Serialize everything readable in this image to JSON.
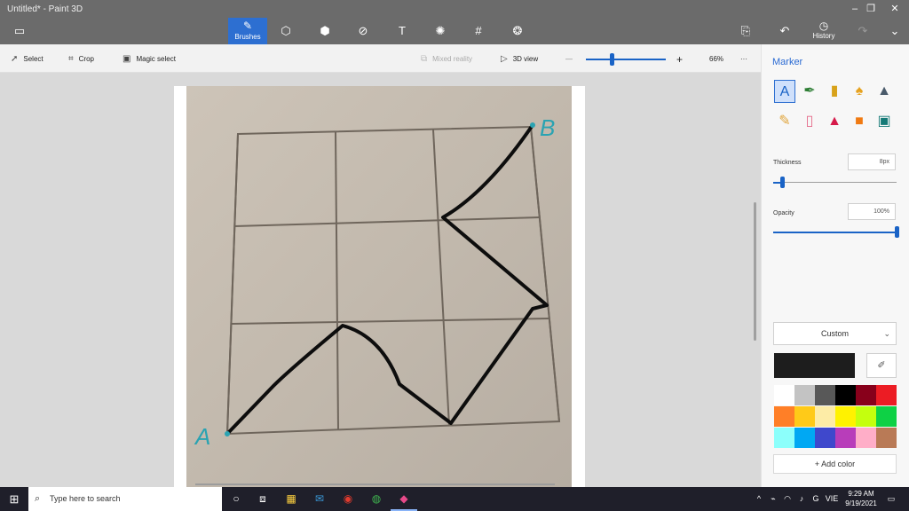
{
  "window": {
    "title": "Untitled* - Paint 3D",
    "minimize_glyph": "–",
    "restore_glyph": "❐",
    "close_glyph": "✕"
  },
  "ribbon": {
    "brushes_label": "Brushes",
    "history_label": "History",
    "icons": [
      "folder-icon",
      "brushes-icon",
      "2d-shapes-icon",
      "3d-shapes-icon",
      "stickers-icon",
      "text-icon",
      "effects-icon",
      "canvas-icon",
      "3d-library-icon",
      "paste-icon",
      "undo-icon",
      "history-icon",
      "redo-icon",
      "expand-icon"
    ]
  },
  "commandbar": {
    "select_label": "Select",
    "crop_label": "Crop",
    "magic_select_label": "Magic select",
    "mixed_reality_label": "Mixed reality",
    "view3d_label": "3D view",
    "zoom_value": "66%",
    "zoom_minus": "—",
    "zoom_plus": "+",
    "more": "···"
  },
  "canvas": {
    "label_a": "A",
    "label_b": "B",
    "grid_rows": 3,
    "grid_cols": 3
  },
  "panel": {
    "title": "Marker",
    "thickness_label": "Thickness",
    "thickness_value": "8px",
    "thickness_level": 0.07,
    "opacity_label": "Opacity",
    "opacity_value": "100%",
    "opacity_level": 1.0,
    "custom_label": "Custom",
    "add_color_label": "Add color",
    "current_color": "#1d1d1d",
    "palette": [
      "#ffffff",
      "#c3c3c3",
      "#585858",
      "#000000",
      "#88001b",
      "#ec1c24",
      "#ff7f27",
      "#ffca18",
      "#fdeca6",
      "#fff200",
      "#c4ff0e",
      "#0ed145",
      "#8cfffb",
      "#00a8f3",
      "#3f48cc",
      "#b83dba",
      "#ffaec8",
      "#b97a56"
    ],
    "tools": [
      "calligraphy-pen",
      "ink-pen",
      "marker",
      "oil-brush",
      "watercolor",
      "pencil",
      "eraser",
      "crayon",
      "spray-can",
      "fill-bucket"
    ]
  },
  "taskbar": {
    "search_placeholder": "Type here to search",
    "language": "VIE",
    "time": "9:29 AM",
    "date": "9/19/2021"
  }
}
